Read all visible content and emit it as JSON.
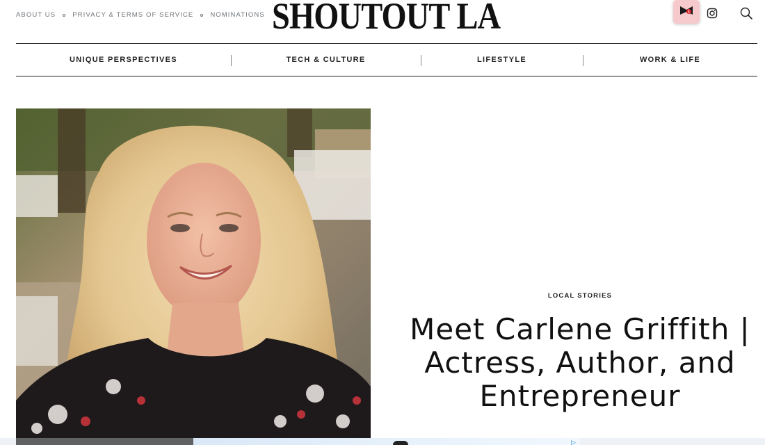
{
  "header": {
    "links": [
      {
        "label": "ABOUT US"
      },
      {
        "label": "PRIVACY & TERMS OF SERVICE"
      },
      {
        "label": "NOMINATIONS"
      }
    ],
    "logo": "SHOUTOUT LA",
    "extension_badge_count": "1",
    "icons": [
      "extension-icon",
      "instagram-icon",
      "search-icon"
    ]
  },
  "nav": {
    "items": [
      {
        "label": "UNIQUE PERSPECTIVES"
      },
      {
        "label": "TECH & CULTURE"
      },
      {
        "label": "LIFESTYLE"
      },
      {
        "label": "WORK & LIFE"
      }
    ]
  },
  "article": {
    "category": "LOCAL STORIES",
    "title": "Meet Carlene Griffith | Actress, Author, and Entrepreneur"
  },
  "colors": {
    "text": "#111111",
    "muted": "#6e7378",
    "badge_bg": "#f6c9cd",
    "ad_choice": "#1a8bd6"
  }
}
